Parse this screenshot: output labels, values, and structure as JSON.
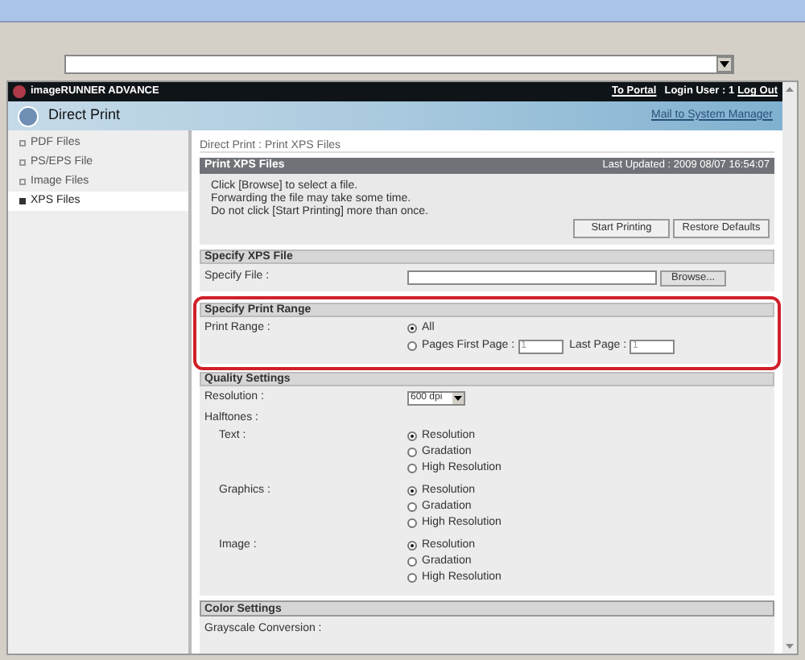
{
  "header": {
    "brand": "imageRUNNER ADVANCE",
    "portal_link": "To Portal",
    "login_user": "Login User : 1",
    "logout_link": "Log Out"
  },
  "page": {
    "title": "Direct Print",
    "mail_link": "Mail to System Manager"
  },
  "sidebar": {
    "items": [
      {
        "label": "PDF Files",
        "selected": false
      },
      {
        "label": "PS/EPS File",
        "selected": false
      },
      {
        "label": "Image Files",
        "selected": false
      },
      {
        "label": "XPS Files",
        "selected": true
      }
    ]
  },
  "breadcrumb": "Direct Print : Print XPS Files",
  "print_panel": {
    "title": "Print XPS Files",
    "last_updated": "Last Updated : 2009 08/07 16:54:07",
    "messages": [
      "Click [Browse] to select a file.",
      "Forwarding the file may take some time.",
      "Do not click [Start Printing] more than once."
    ],
    "buttons": [
      "Start Printing",
      "Restore Defaults"
    ]
  },
  "file_section": {
    "title": "Specify XPS File",
    "label": "Specify File :",
    "button": "Browse..."
  },
  "range_section": {
    "title": "Specify Print Range",
    "highlighted": true,
    "label": "Print Range :",
    "options": [
      {
        "label": "All",
        "selected": true
      },
      {
        "label": "Pages First Page :",
        "selected": false
      }
    ],
    "first_page": "1",
    "last_page_label": "Last Page :",
    "last_page": "1"
  },
  "quality_section": {
    "title": "Quality Settings",
    "resolution_label": "Resolution :",
    "resolution": "600 dpi",
    "halftones_label": "Halftones :",
    "groups": [
      {
        "label": "Text :",
        "options": [
          {
            "label": "Resolution",
            "selected": true
          },
          {
            "label": "Gradation",
            "selected": false
          },
          {
            "label": "High Resolution",
            "selected": false
          }
        ]
      },
      {
        "label": "Graphics :",
        "options": [
          {
            "label": "Resolution",
            "selected": true
          },
          {
            "label": "Gradation",
            "selected": false
          },
          {
            "label": "High Resolution",
            "selected": false
          }
        ]
      },
      {
        "label": "Image :",
        "options": [
          {
            "label": "Resolution",
            "selected": true
          },
          {
            "label": "Gradation",
            "selected": false
          },
          {
            "label": "High Resolution",
            "selected": false
          }
        ]
      }
    ]
  },
  "color_section": {
    "title": "Color Settings",
    "label": "Grayscale Conversion :"
  }
}
